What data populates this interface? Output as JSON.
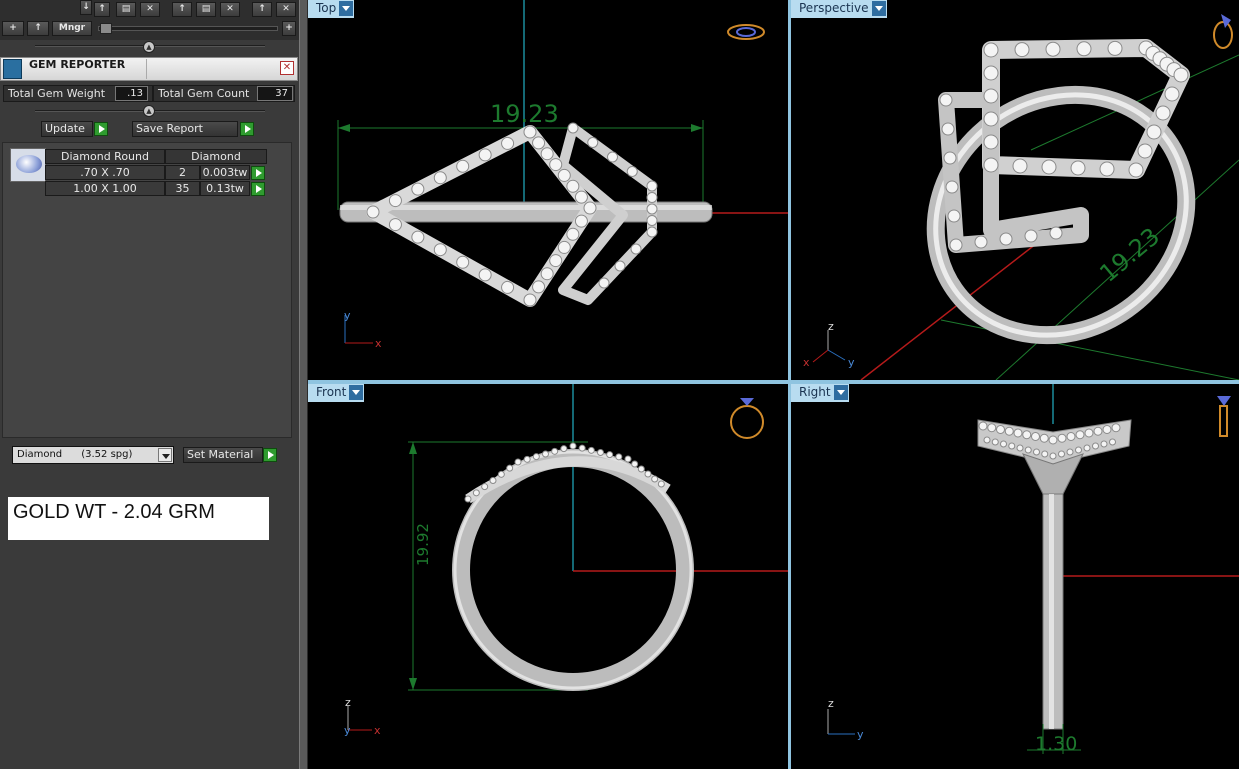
{
  "toolbar": {
    "add_label": "+",
    "up_label": "↑",
    "manager_label": "Mngr",
    "plus_right_label": "+"
  },
  "gem_reporter": {
    "title": "GEM REPORTER",
    "close_label": "✕",
    "total_gem_weight_label": "Total Gem Weight",
    "total_gem_weight_value": ".13",
    "total_gem_count_label": "Total Gem Count",
    "total_gem_count_value": "37",
    "update_label": "Update",
    "save_report_label": "Save Report",
    "table": {
      "headers": [
        "Diamond Round",
        "Diamond"
      ],
      "rows": [
        {
          "size": ".70 X .70",
          "count": "2",
          "weight": "0.003tw"
        },
        {
          "size": "1.00 X 1.00",
          "count": "35",
          "weight": "0.13tw"
        }
      ]
    },
    "material_select": "Diamond      (3.52 spg)",
    "set_material_label": "Set Material"
  },
  "note": {
    "gold_weight": "GOLD WT - 2.04 GRM"
  },
  "viewports": {
    "top": {
      "label": "Top",
      "dimension": "19.23",
      "axis_vertical": "y",
      "axis_horizontal": "x"
    },
    "perspective": {
      "label": "Perspective",
      "dimension": "19.23",
      "axis_z": "z",
      "axis_x": "x",
      "axis_y": "y"
    },
    "front": {
      "label": "Front",
      "dimension": "19.92",
      "axis_vertical": "z",
      "axis_horizontal": "x",
      "axis_small": "y"
    },
    "right": {
      "label": "Right",
      "dimension": "1.30",
      "axis_vertical": "z",
      "axis_horizontal": "y"
    }
  },
  "colors": {
    "dimension_green": "#1d7a2e",
    "axis_red": "#b51a1a",
    "axis_cyan": "#1a8c9c",
    "label_bg": "#b8dcf0",
    "metal": "#c9c9c9"
  }
}
